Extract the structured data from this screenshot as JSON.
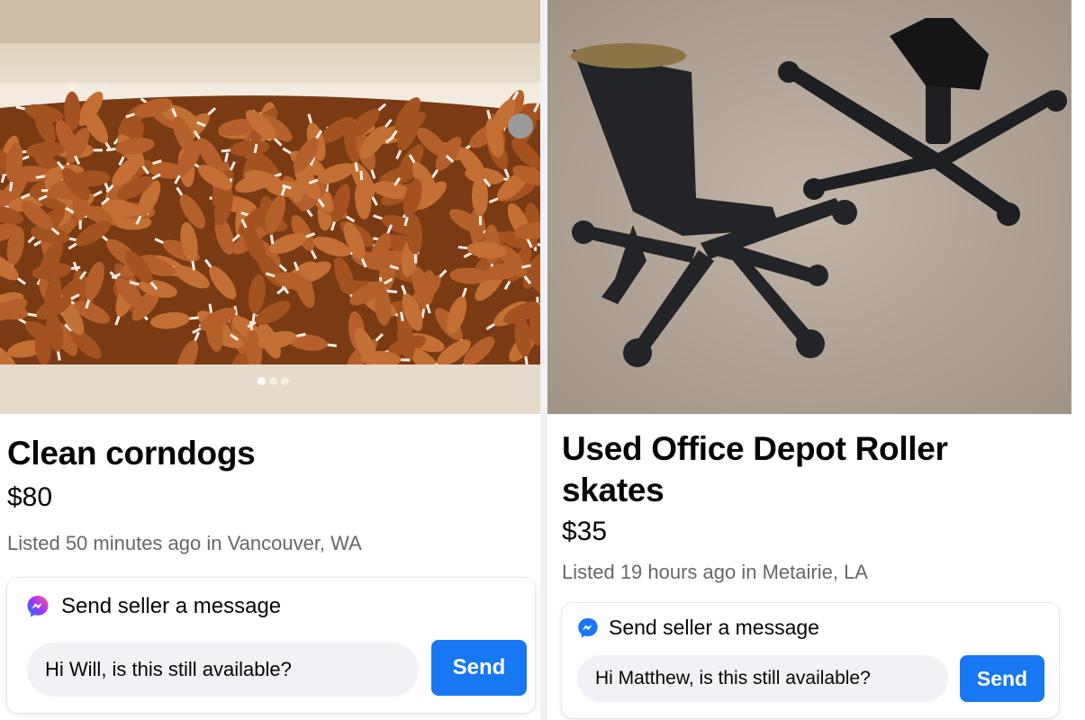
{
  "listings": [
    {
      "title": "Clean corndogs",
      "price": "$80",
      "meta": "Listed 50 minutes ago in Vancouver, WA",
      "photo_icon": "corndogs-in-bathtub-photo",
      "carousel": {
        "count": 3,
        "active": 1
      },
      "message": {
        "heading": "Send seller a message",
        "icon": "messenger-icon",
        "input_value": "Hi Will, is this still available?",
        "send_label": "Send"
      }
    },
    {
      "title": "Used Office Depot Roller skates",
      "price": "$35",
      "meta": "Listed 19 hours ago in Metairie, LA",
      "photo_icon": "boots-on-chair-bases-photo",
      "message": {
        "heading": "Send seller a message",
        "icon": "messenger-icon",
        "input_value": "Hi Matthew, is this still available?",
        "send_label": "Send"
      }
    }
  ],
  "colors": {
    "accent": "#1877f2",
    "secondary_text": "#65676b",
    "input_bg": "#f0f2f5"
  }
}
